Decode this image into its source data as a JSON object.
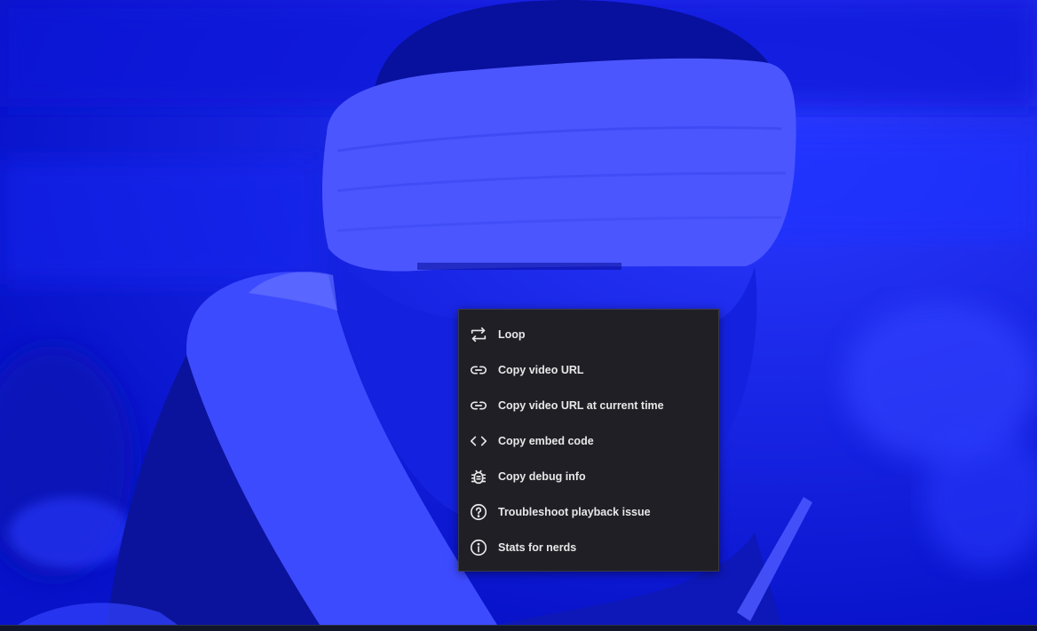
{
  "player": {
    "tint_color": "#0a14e8"
  },
  "context_menu": {
    "items": [
      {
        "label": "Loop",
        "icon": "loop-icon"
      },
      {
        "label": "Copy video URL",
        "icon": "link-icon"
      },
      {
        "label": "Copy video URL at current time",
        "icon": "link-icon"
      },
      {
        "label": "Copy embed code",
        "icon": "embed-code-icon"
      },
      {
        "label": "Copy debug info",
        "icon": "bug-icon"
      },
      {
        "label": "Troubleshoot playback issue",
        "icon": "help-circle-icon"
      },
      {
        "label": "Stats for nerds",
        "icon": "info-circle-icon"
      }
    ]
  }
}
